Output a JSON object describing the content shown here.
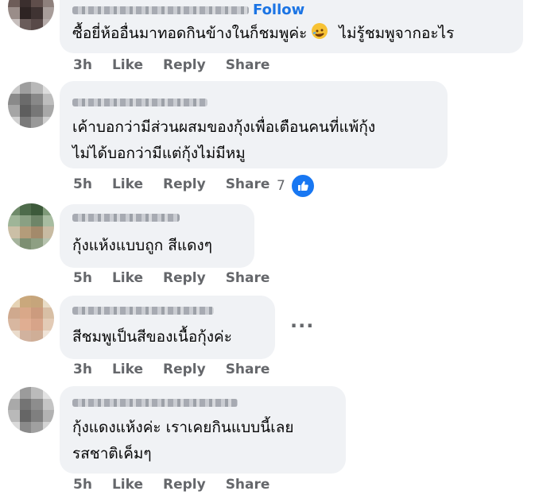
{
  "comments": [
    {
      "follow": "Follow",
      "lines": [
        "ซื้อยี่ห้ออื่นมาทอดกินข้างในก็ชมพูค่ะ",
        "ไม่รู้ชมพูจากอะไร"
      ],
      "emoji": "rolling-laughing-emoji",
      "time": "3h",
      "like": "Like",
      "reply": "Reply",
      "share": "Share"
    },
    {
      "lines": [
        "เค้าบอกว่ามีส่วนผสมของกุ้งเพื่อเตือนคนที่แพ้กุ้ง",
        "ไม่ได้บอกว่ามีแต่กุ้งไม่มีหมู"
      ],
      "time": "5h",
      "like": "Like",
      "reply": "Reply",
      "share": "Share",
      "reaction_count": "7"
    },
    {
      "lines": [
        "กุ้งแห้งแบบถูก สีแดงๆ"
      ],
      "time": "5h",
      "like": "Like",
      "reply": "Reply",
      "share": "Share"
    },
    {
      "lines": [
        "สีชมพูเป็นสีของเนื้อกุ้งค่ะ"
      ],
      "time": "3h",
      "like": "Like",
      "reply": "Reply",
      "share": "Share",
      "more": "···"
    },
    {
      "lines": [
        "กุ้งแดงแห้งค่ะ เราเคยกินแบบนี้เลย",
        "รสชาติเค็มๆ"
      ],
      "time": "5h",
      "like": "Like",
      "reply": "Reply",
      "share": "Share"
    }
  ],
  "colors": {
    "accent": "#1b74e4",
    "bubble": "#f0f2f5",
    "muted": "#65676b",
    "like_blue": "#1877f2"
  }
}
